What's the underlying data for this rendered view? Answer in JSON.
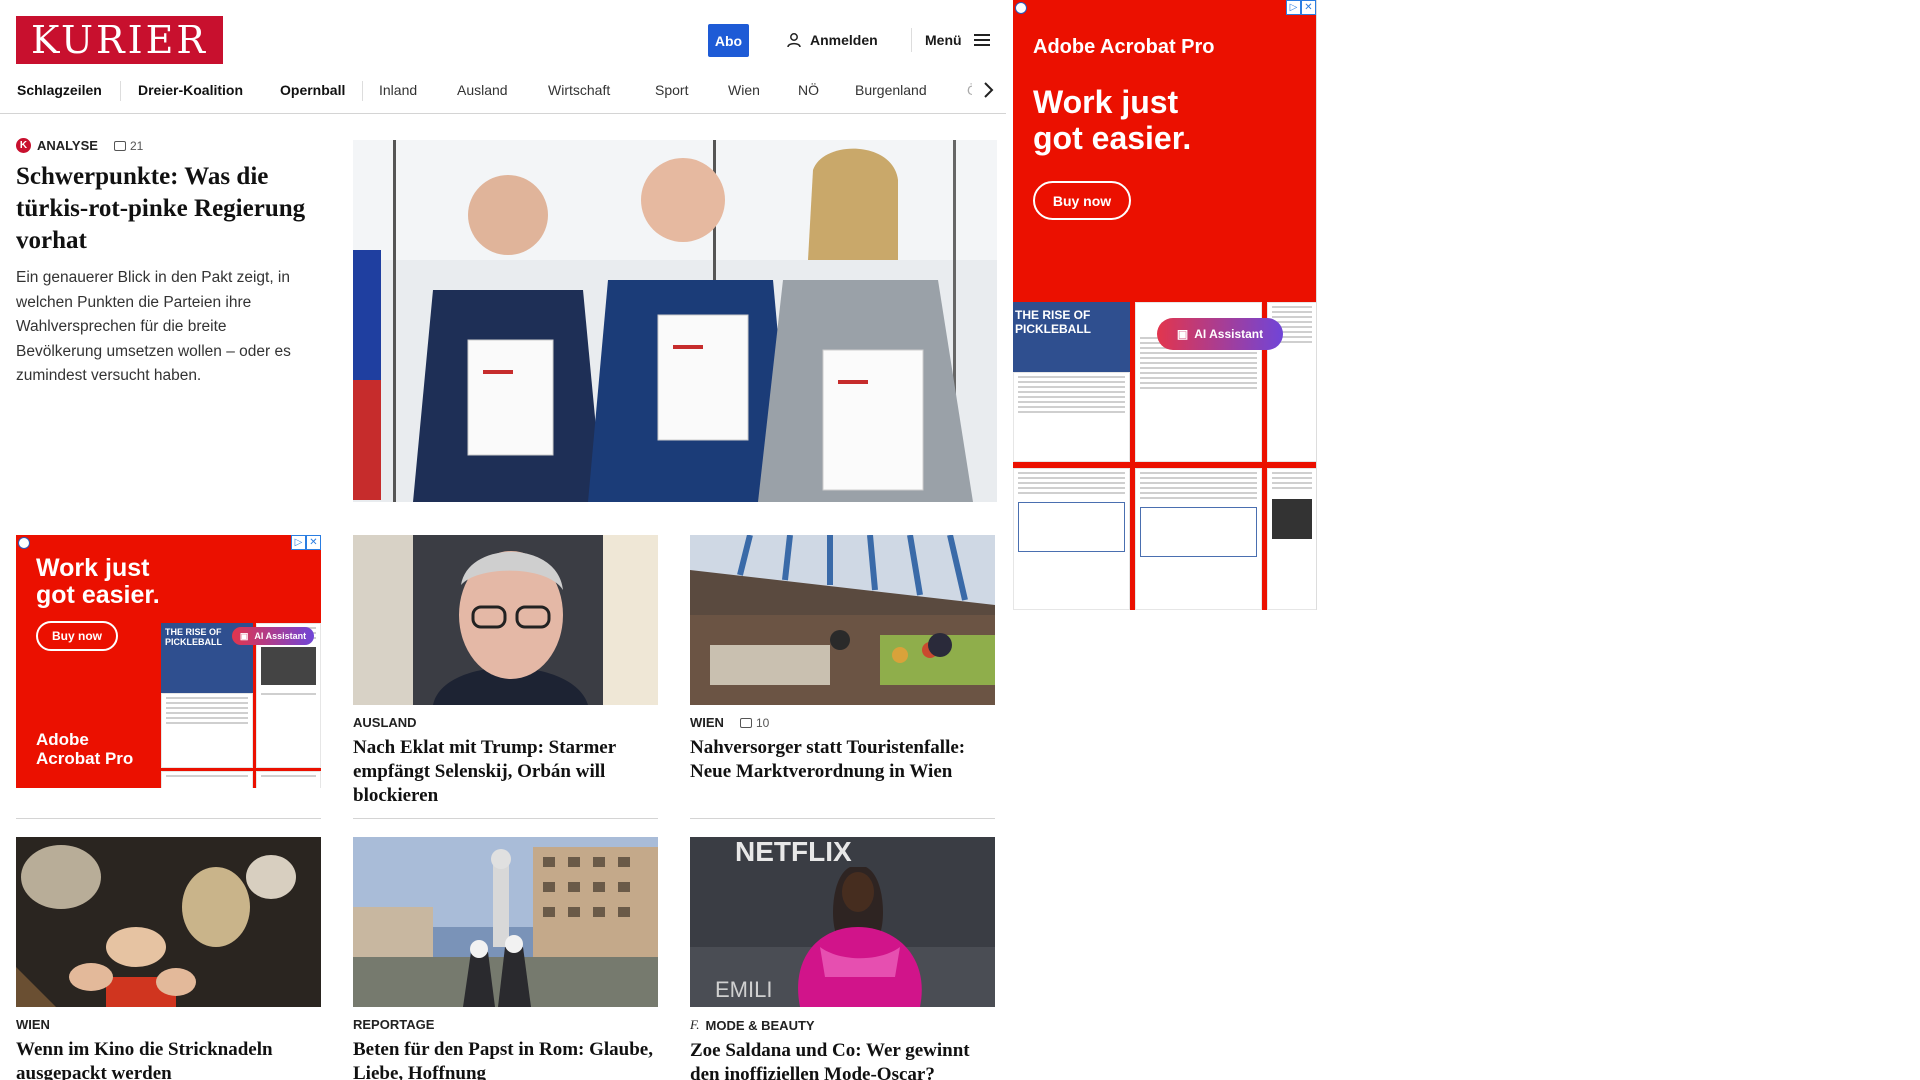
{
  "header": {
    "logo": "KURIER",
    "abo_label": "Abo",
    "login_label": "Anmelden",
    "menu_label": "Menü"
  },
  "nav": {
    "items": [
      "Schlagzeilen",
      "Dreier-Koalition",
      "Opernball",
      "Inland",
      "Ausland",
      "Wirtschaft",
      "Sport",
      "Wien",
      "NÖ",
      "Burgenland",
      "Ö…"
    ]
  },
  "lead": {
    "kicker": "ANALYSE",
    "comments": "21",
    "title": "Schwerpunkte: Was die türkis-rot-pinke Regierung vorhat",
    "teaser": "Ein genauerer Blick in den Pakt zeigt, in welchen Punkten die Parteien ihre Wahlversprechen für die breite Bevölkerung umsetzen wollen – oder es zumindest versucht haben."
  },
  "cards": [
    {
      "kicker": "AUSLAND",
      "title": "Nach Eklat mit Trump: Starmer empfängt Selenskij, Orbán will blockieren"
    },
    {
      "kicker": "WIEN",
      "comments": "10",
      "title": "Nahversorger statt Touristenfalle: Neue Marktverordnung in Wien"
    },
    {
      "kicker": "WIEN",
      "title": "Wenn im Kino die Stricknadeln ausgepackt werden"
    },
    {
      "kicker": "REPORTAGE",
      "title": "Beten für den Papst in Rom: Glaube, Liebe, Hoffnung"
    },
    {
      "kicker": "MODE & BEAUTY",
      "title": "Zoe Saldana und Co: Wer gewinnt den inoffiziellen Mode-Oscar?"
    }
  ],
  "ad_small": {
    "headline": "Work just got easier.",
    "buy": "Buy now",
    "brand_line1": "Adobe",
    "brand_line2": "Acrobat Pro",
    "doc_title": "THE RISE OF PICKLEBALL",
    "ai": "AI Assistant"
  },
  "ad_right": {
    "brand": "Adobe Acrobat Pro",
    "headline": "Work just got easier.",
    "buy": "Buy now",
    "doc_title": "THE RISE OF PICKLEBALL",
    "ai": "AI Assistant"
  },
  "photo_text": {
    "netflix": "NETFLIX",
    "emilia": "EMILI"
  },
  "colors": {
    "brand_red": "#c8102e",
    "abo_blue": "#1e5bd6",
    "adobe_red": "#eb1000"
  }
}
